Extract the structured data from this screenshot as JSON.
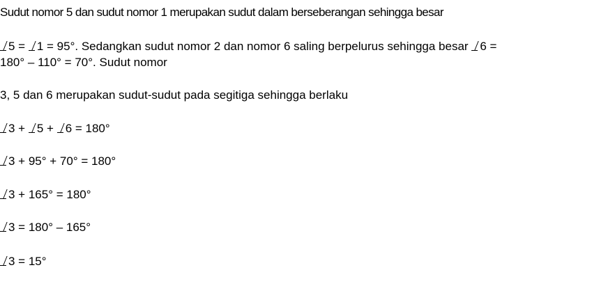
{
  "lines": {
    "l1": "Sudut nomor 5 dan sudut nomor 1 merupakan sudut dalam berseberangan sehingga besar",
    "l2": "5 = ",
    "l2b": "1 = 95°. Sedangkan sudut nomor 2 dan nomor 6 saling berpelurus sehingga besar ",
    "l2c": "6 =",
    "l3": "180° – 110° = 70°. Sudut nomor",
    "l4": "3, 5 dan 6 merupakan sudut-sudut pada segitiga sehingga berlaku",
    "l5a": "3 + ",
    "l5b": "5 + ",
    "l5c": "6 = 180°",
    "l6": "3 + 95° + 70° = 180°",
    "l7": "3 + 165° = 180°",
    "l8": "3 = 180° – 165°",
    "l9": "3 = 15°"
  },
  "symbols": {
    "angle_symbol": "angle-icon"
  }
}
